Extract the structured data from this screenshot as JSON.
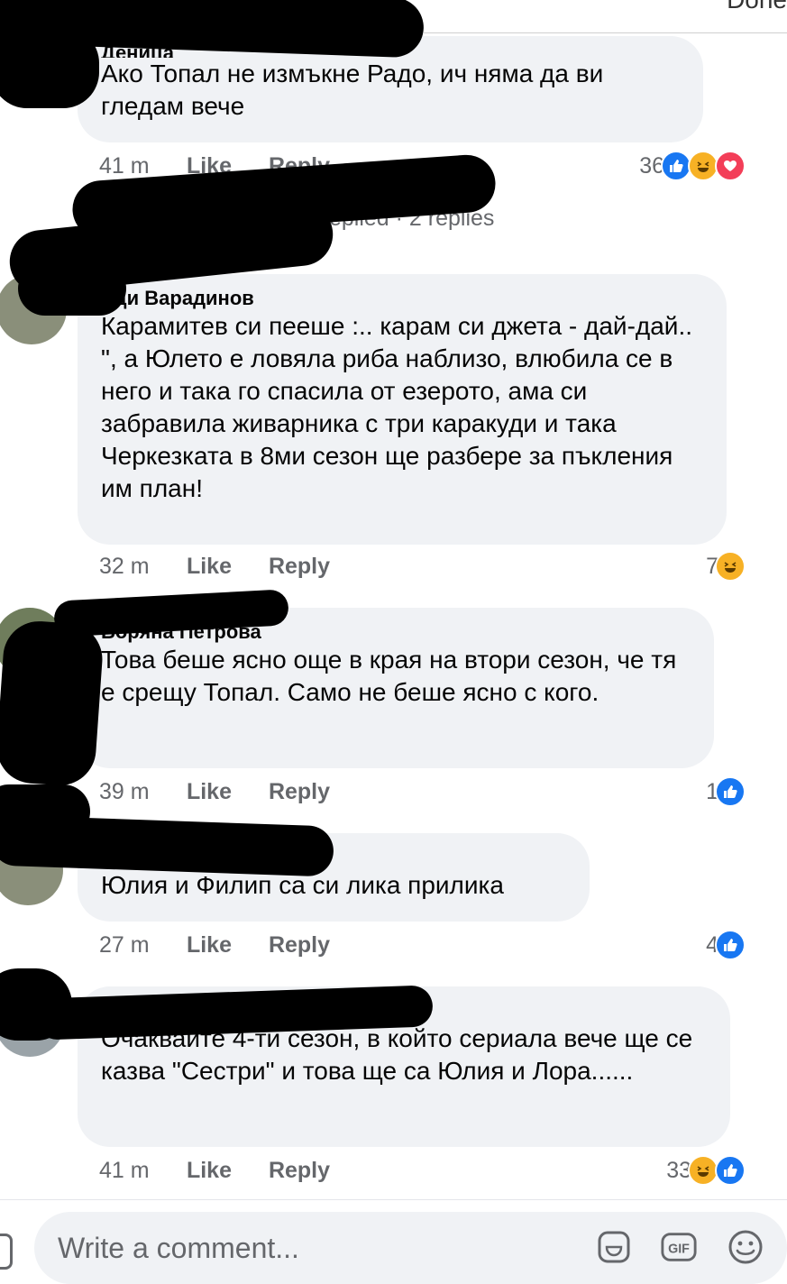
{
  "header": {
    "done_label": "Done"
  },
  "comments": [
    {
      "author": "Деница",
      "text": "Ако Топал не измъкне Радо, ич няма да ви гледам вече",
      "time": "41 m",
      "like": "Like",
      "reply": "Reply",
      "reactions": "36",
      "icons": [
        "like",
        "haha",
        "love"
      ]
    },
    {
      "author": "Еди Варадинов",
      "text": "Карамитев си пееше :.. карам си джета - дай-дай.. \", а Юлето е ловяла риба наблизо, влюбила се в него и така го спасила от езерото, ама си забравила живарника с три каракуди и така Черкезката в 8ми сезон ще разбере за пъкления им план!",
      "time": "32 m",
      "like": "Like",
      "reply": "Reply",
      "reactions": "7",
      "icons": [
        "haha"
      ]
    },
    {
      "author": "Боряна Петрова",
      "text": "Това беше ясно още в края на втори сезон, че тя е срещу Топал. Само не беше ясно с кого.",
      "time": "39 m",
      "like": "Like",
      "reply": "Reply",
      "reactions": "1",
      "icons": [
        "like"
      ]
    },
    {
      "author": "",
      "text": "Юлия и Филип са си лика прилика",
      "time": "27 m",
      "like": "Like",
      "reply": "Reply",
      "reactions": "4",
      "icons": [
        "like"
      ]
    },
    {
      "author": "",
      "text": "Очаквайте 4-ти сезон, в който сериала вече ще се казва \"Сестри\" и това ще са Юлия и Лора......",
      "time": "41 m",
      "like": "Like",
      "reply": "Reply",
      "reactions": "33",
      "icons": [
        "haha",
        "like"
      ]
    }
  ],
  "replies_line": "Bonbon Toncheva replied · 2 replies",
  "composer": {
    "placeholder": "Write a comment..."
  },
  "colors": {
    "like": "#1877f2",
    "haha": "#f7b125",
    "love": "#f33e58",
    "bubble": "#f0f2f5",
    "meta": "#65676b"
  }
}
